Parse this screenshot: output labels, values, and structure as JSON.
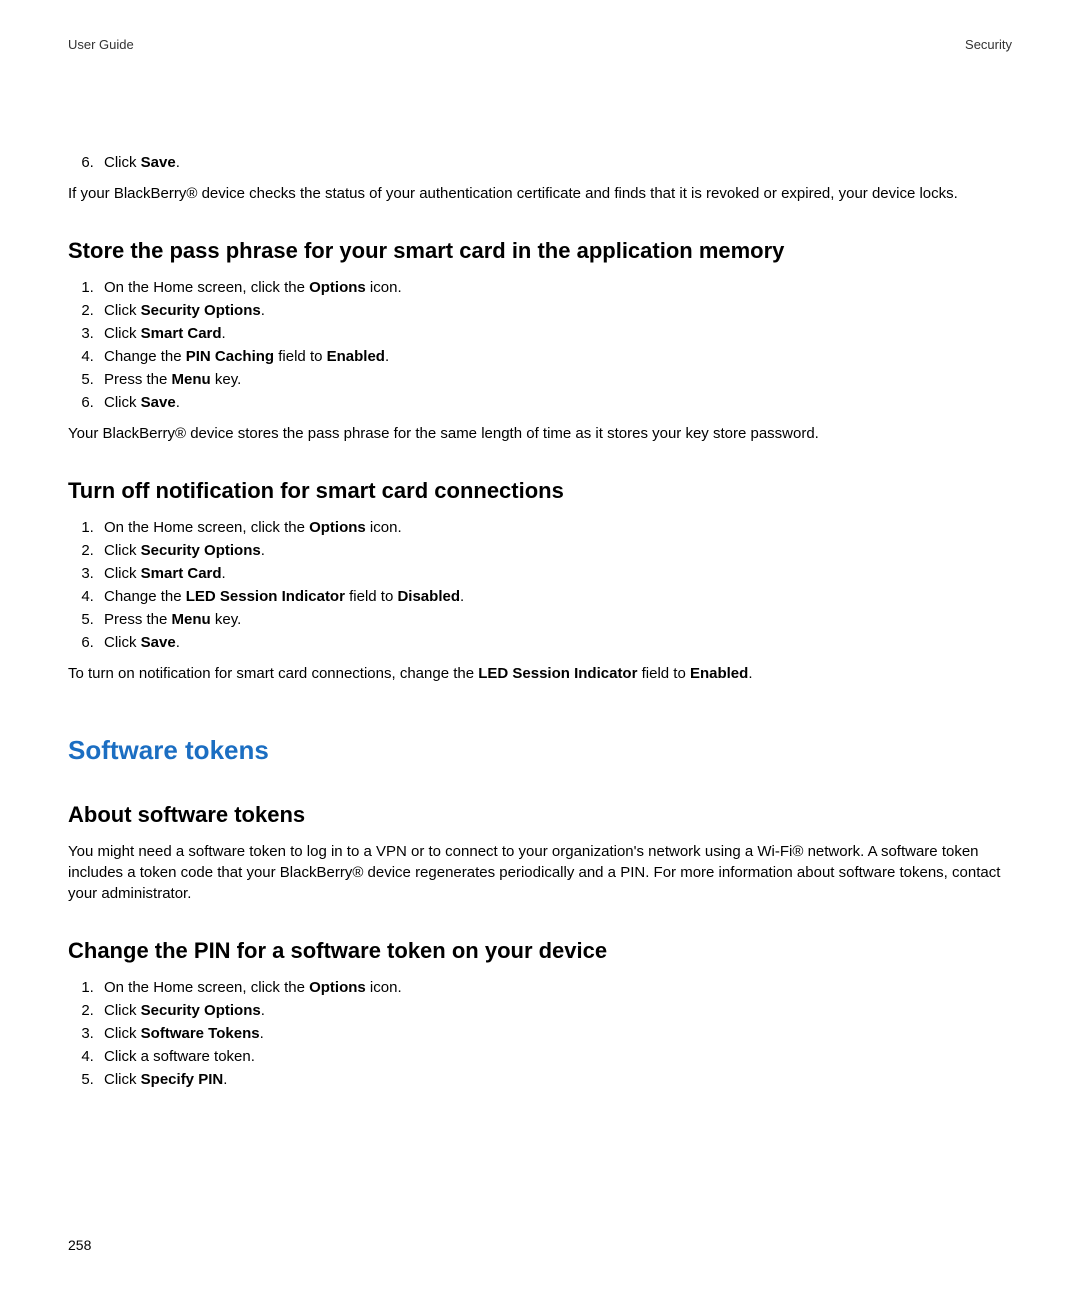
{
  "header": {
    "left": "User Guide",
    "right": "Security"
  },
  "top_step": {
    "n": "6.",
    "pre": "Click ",
    "bold": "Save",
    "post": "."
  },
  "top_para": "If your BlackBerry® device checks the status of your authentication certificate and finds that it is revoked or expired, your device locks.",
  "sec1": {
    "title": "Store the pass phrase for your smart card in the application memory",
    "steps": [
      {
        "n": "1.",
        "pre": "On the Home screen, click the ",
        "bold": "Options",
        "post": " icon."
      },
      {
        "n": "2.",
        "pre": "Click ",
        "bold": "Security Options",
        "post": "."
      },
      {
        "n": "3.",
        "pre": "Click ",
        "bold": "Smart Card",
        "post": "."
      },
      {
        "n": "4.",
        "pre": "Change the ",
        "bold": "PIN Caching",
        "mid": " field to ",
        "bold2": "Enabled",
        "post": "."
      },
      {
        "n": "5.",
        "pre": "Press the ",
        "bold": "Menu",
        "post": " key."
      },
      {
        "n": "6.",
        "pre": "Click ",
        "bold": "Save",
        "post": "."
      }
    ],
    "para": "Your BlackBerry® device stores the pass phrase for the same length of time as it stores your key store password."
  },
  "sec2": {
    "title": "Turn off notification for smart card connections",
    "steps": [
      {
        "n": "1.",
        "pre": "On the Home screen, click the ",
        "bold": "Options",
        "post": " icon."
      },
      {
        "n": "2.",
        "pre": "Click ",
        "bold": "Security Options",
        "post": "."
      },
      {
        "n": "3.",
        "pre": "Click ",
        "bold": "Smart Card",
        "post": "."
      },
      {
        "n": "4.",
        "pre": "Change the ",
        "bold": "LED Session Indicator",
        "mid": " field to ",
        "bold2": "Disabled",
        "post": "."
      },
      {
        "n": "5.",
        "pre": "Press the ",
        "bold": "Menu",
        "post": " key."
      },
      {
        "n": "6.",
        "pre": "Click ",
        "bold": "Save",
        "post": "."
      }
    ],
    "para_pre": "To turn on notification for smart card connections, change the ",
    "para_b1": "LED Session Indicator",
    "para_mid": " field to ",
    "para_b2": "Enabled",
    "para_post": "."
  },
  "sec_tokens_title": "Software tokens",
  "sec3": {
    "title": "About software tokens",
    "para": "You might need a software token to log in to a VPN or to connect to your organization's network using a Wi-Fi® network. A software token includes a token code that your BlackBerry® device regenerates periodically and a PIN. For more information about software tokens, contact your administrator."
  },
  "sec4": {
    "title": "Change the PIN for a software token on your device",
    "steps": [
      {
        "n": "1.",
        "pre": "On the Home screen, click the ",
        "bold": "Options",
        "post": " icon."
      },
      {
        "n": "2.",
        "pre": "Click ",
        "bold": "Security Options",
        "post": "."
      },
      {
        "n": "3.",
        "pre": "Click ",
        "bold": "Software Tokens",
        "post": "."
      },
      {
        "n": "4.",
        "pre": "Click a software token.",
        "bold": "",
        "post": ""
      },
      {
        "n": "5.",
        "pre": "Click ",
        "bold": "Specify PIN",
        "post": "."
      }
    ]
  },
  "page_number": "258"
}
